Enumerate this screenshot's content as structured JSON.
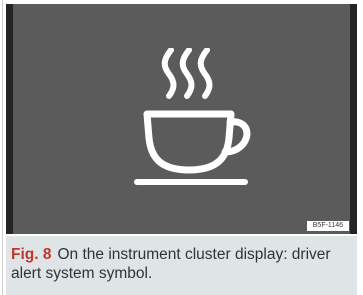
{
  "figure": {
    "code": "B5F-1146",
    "icon": "coffee-cup-icon",
    "colors": {
      "panel_background": "#5b5b5b",
      "panel_border": "#242424",
      "icon": "#ffffff",
      "caption_background": "#dfe5e6",
      "label_accent": "#c0372f"
    }
  },
  "caption": {
    "label": "Fig. 8",
    "text": "On the instrument cluster display: driver alert system symbol."
  }
}
